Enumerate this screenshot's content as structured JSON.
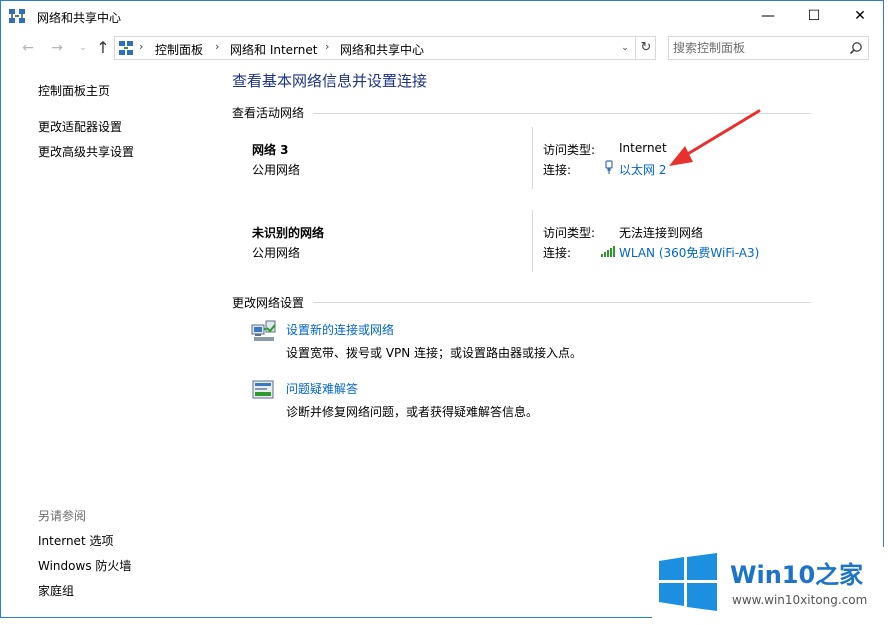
{
  "window": {
    "title": "网络和共享中心",
    "controls": {
      "minimize": "—",
      "maximize": "☐",
      "close": "✕"
    }
  },
  "nav": {
    "back": "←",
    "forward": "→",
    "recent": "⌄",
    "up": "↑"
  },
  "address": {
    "crumbs": [
      "控制面板",
      "网络和 Internet",
      "网络和共享中心"
    ],
    "separator": "›",
    "dropdown": "⌄",
    "refresh": "↻"
  },
  "search": {
    "placeholder": "搜索控制面板"
  },
  "sidebar": {
    "links": [
      "控制面板主页",
      "更改适配器设置",
      "更改高级共享设置"
    ],
    "see_also_heading": "另请参阅",
    "see_also": [
      "Internet 选项",
      "Windows 防火墙",
      "家庭组"
    ]
  },
  "main": {
    "heading": "查看基本网络信息并设置连接",
    "active_section": "查看活动网络",
    "networks": [
      {
        "name": "网络  3",
        "type": "公用网络",
        "access_label": "访问类型:",
        "access": "Internet",
        "conn_label": "连接:",
        "conn": "以太网 2",
        "conn_icon": "ethernet-icon"
      },
      {
        "name": "未识别的网络",
        "type": "公用网络",
        "access_label": "访问类型:",
        "access": "无法连接到网络",
        "conn_label": "连接:",
        "conn": "WLAN (360免费WiFi-A3)",
        "conn_icon": "wifi-signal-icon"
      }
    ],
    "change_section": "更改网络设置",
    "tasks": [
      {
        "title": "设置新的连接或网络",
        "desc": "设置宽带、拨号或 VPN 连接；或设置路由器或接入点。",
        "icon": "network-setup-icon"
      },
      {
        "title": "问题疑难解答",
        "desc": "诊断并修复网络问题，或者获得疑难解答信息。",
        "icon": "troubleshoot-icon"
      }
    ]
  },
  "background_fragments": [
    "W",
    "W",
    ",",
    "ʼ",
    "1"
  ],
  "watermark": {
    "brand": "Win10之家",
    "site": "www.win10xitong.com"
  },
  "colors": {
    "heading": "#1e3287",
    "link": "#0066cc",
    "window_border": "#2b7ed6",
    "annotation_arrow": "#e8312f",
    "wm_logo": "#1d8fe1"
  }
}
